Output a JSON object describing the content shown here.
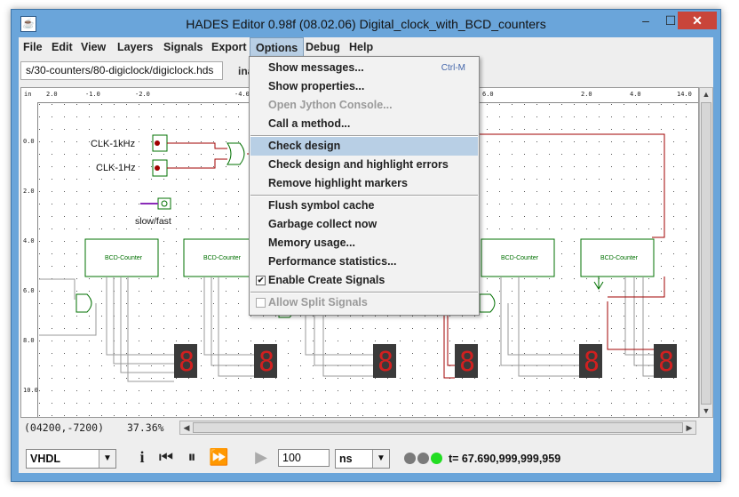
{
  "window": {
    "title": "HADES Editor 0.98f (08.02.06)   Digital_clock_with_BCD_counters",
    "app_icon": "java-cup-icon",
    "controls": {
      "minimize": "–",
      "maximize": "☐",
      "close": "✕"
    }
  },
  "menubar": {
    "items": [
      "File",
      "Edit",
      "View",
      "Layers",
      "Signals",
      "Export",
      "Options",
      "Debug",
      "Help"
    ],
    "active": "Options"
  },
  "toolbar": {
    "path": "s/30-counters/80-digiclock/digiclock.hds",
    "info_clipped": "ina"
  },
  "ruler": {
    "top_labels": [
      "in",
      "2.0",
      "-1.0",
      "-2.0",
      "-4.0",
      "6.0",
      "2.0",
      "4.0",
      "14.0"
    ],
    "left_labels": [
      "0.0",
      "2.0",
      "4.0",
      "6.0",
      "8.0",
      "10.0"
    ]
  },
  "schematic": {
    "clock_labels": [
      "CLK-1kHz",
      "CLK-1Hz"
    ],
    "switch_label": "slow/fast",
    "counter_label": "BCD-Counter",
    "display_digit": "8",
    "signal_colors": {
      "wire": "#a00000",
      "bus": "#808080",
      "component": "#007000"
    }
  },
  "options_menu": {
    "items": [
      {
        "label": "Show messages...",
        "shortcut": "Ctrl-M",
        "enabled": true
      },
      {
        "label": "Show properties...",
        "enabled": true
      },
      {
        "label": "Open Jython Console...",
        "enabled": false
      },
      {
        "label": "Call a method...",
        "enabled": true
      },
      {
        "label": "Check design",
        "enabled": true,
        "highlighted": true
      },
      {
        "label": "Check design and highlight errors",
        "enabled": true
      },
      {
        "label": "Remove highlight markers",
        "enabled": true
      },
      {
        "label": "Flush symbol cache",
        "enabled": true
      },
      {
        "label": "Garbage collect now",
        "enabled": true
      },
      {
        "label": "Memory usage...",
        "enabled": true
      },
      {
        "label": "Performance statistics...",
        "enabled": true
      },
      {
        "label": "Enable Create Signals",
        "enabled": true,
        "checked": true
      },
      {
        "label": "Allow Split Signals",
        "enabled": false,
        "checked": false
      }
    ]
  },
  "status": {
    "coords": "(04200,-7200)",
    "zoom": "37.36%"
  },
  "controls": {
    "language": "VHDL",
    "time_value": "100",
    "time_unit": "ns",
    "sim_time": "t= 67.690,999,999,959",
    "leds": [
      "#7a7a7a",
      "#7a7a7a",
      "#22dd22"
    ]
  }
}
